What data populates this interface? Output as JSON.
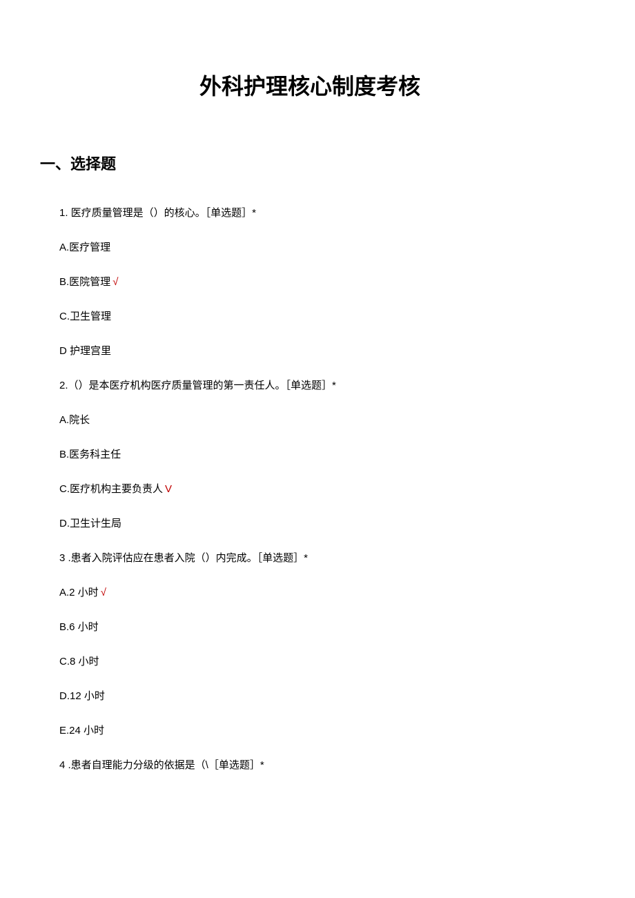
{
  "title": "外科护理核心制度考核",
  "section": "一、选择题",
  "questions": [
    {
      "text": "1. 医疗质量管理是（）的核心。［单选题］*",
      "options": [
        {
          "label": "A.医疗管理",
          "correct": false,
          "mark": ""
        },
        {
          "label": "B.医院管理",
          "correct": true,
          "mark": "√"
        },
        {
          "label": "C.卫生管理",
          "correct": false,
          "mark": ""
        },
        {
          "label": "D 护理宫里",
          "correct": false,
          "mark": ""
        }
      ]
    },
    {
      "text": "2.（）是本医疗机构医疗质量管理的第一责任人。［单选题］*",
      "options": [
        {
          "label": "A.院长",
          "correct": false,
          "mark": ""
        },
        {
          "label": "B.医务科主任",
          "correct": false,
          "mark": ""
        },
        {
          "label": "C.医疗机构主要负责人",
          "correct": true,
          "mark": "V"
        },
        {
          "label": "D.卫生计生局",
          "correct": false,
          "mark": ""
        }
      ]
    },
    {
      "text": "3   .患者入院评估应在患者入院（）内完成。［单选题］*",
      "options": [
        {
          "label": "A.2 小时",
          "correct": true,
          "mark": "√"
        },
        {
          "label": "B.6 小时",
          "correct": false,
          "mark": ""
        },
        {
          "label": "C.8 小时",
          "correct": false,
          "mark": ""
        },
        {
          "label": "D.12 小时",
          "correct": false,
          "mark": ""
        },
        {
          "label": "E.24 小时",
          "correct": false,
          "mark": ""
        }
      ]
    },
    {
      "text": "4   .患者自理能力分级的依据是（\\［单选题］*",
      "options": []
    }
  ]
}
